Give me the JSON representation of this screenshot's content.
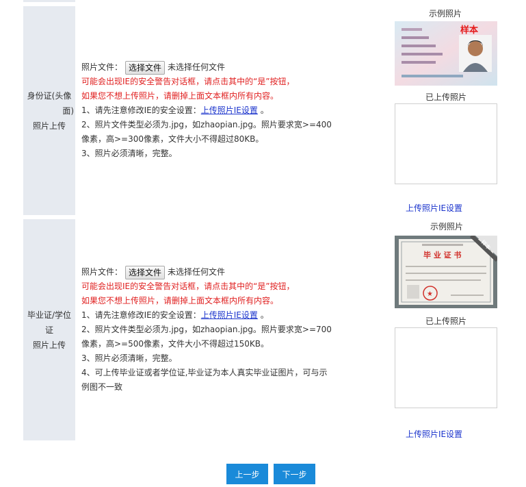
{
  "id_section": {
    "label_line1": "身份证(头像",
    "label_line2": "面)",
    "label_line3": "照片上传",
    "file_label": "照片文件：",
    "file_button": "选择文件",
    "file_status": "未选择任何文件",
    "warn1": "可能会出现IE的安全警告对话框，请点击其中的“是”按钮，",
    "warn2": "如果您不想上传照片，请删掉上面文本框内所有内容。",
    "note1_prefix": "1、请先注意修改IE的安全设置：",
    "note1_link": "上传照片IE设置",
    "note1_suffix": "。",
    "note2a": "2、照片文件类型必须为.jpg，如zhaopian.jpg。照片要求宽>=400",
    "note2b": "像素，高>=300像素，文件大小不得超过80KB。",
    "note3": "3、照片必须清晰，完整。",
    "sample_caption": "示例照片",
    "sample_stamp": "样本",
    "uploaded_caption": "已上传照片",
    "ie_link": "上传照片IE设置"
  },
  "diploma_section": {
    "label_line1": "毕业证/学位证",
    "label_line2": "照片上传",
    "file_label": "照片文件：",
    "file_button": "选择文件",
    "file_status": "未选择任何文件",
    "warn1": "可能会出现IE的安全警告对话框，请点击其中的“是”按钮，",
    "warn2": "如果您不想上传照片，请删掉上面文本框内所有内容。",
    "note1_prefix": "1、请先注意修改IE的安全设置：",
    "note1_link": "上传照片IE设置",
    "note1_suffix": "。",
    "note2a": "2、照片文件类型必须为.jpg，如zhaopian.jpg。照片要求宽>=700",
    "note2b": "像素，高>=500像素，文件大小不得超过150KB。",
    "note3": "3、照片必须清晰，完整。",
    "note4a": "4、可上传毕业证或者学位证,毕业证为本人真实毕业证图片，可与示",
    "note4b": "例图不一致",
    "sample_caption": "示例照片",
    "cert_title": "毕 业 证 书",
    "cert_corner": "样本",
    "uploaded_caption": "已上传照片",
    "ie_link": "上传照片IE设置"
  },
  "nav": {
    "prev": "上一步",
    "next": "下一步"
  },
  "colors": {
    "accent": "#1a8ad9",
    "label_bg": "#e6eaf0",
    "warning": "#e02020",
    "link": "#1a33cc"
  }
}
